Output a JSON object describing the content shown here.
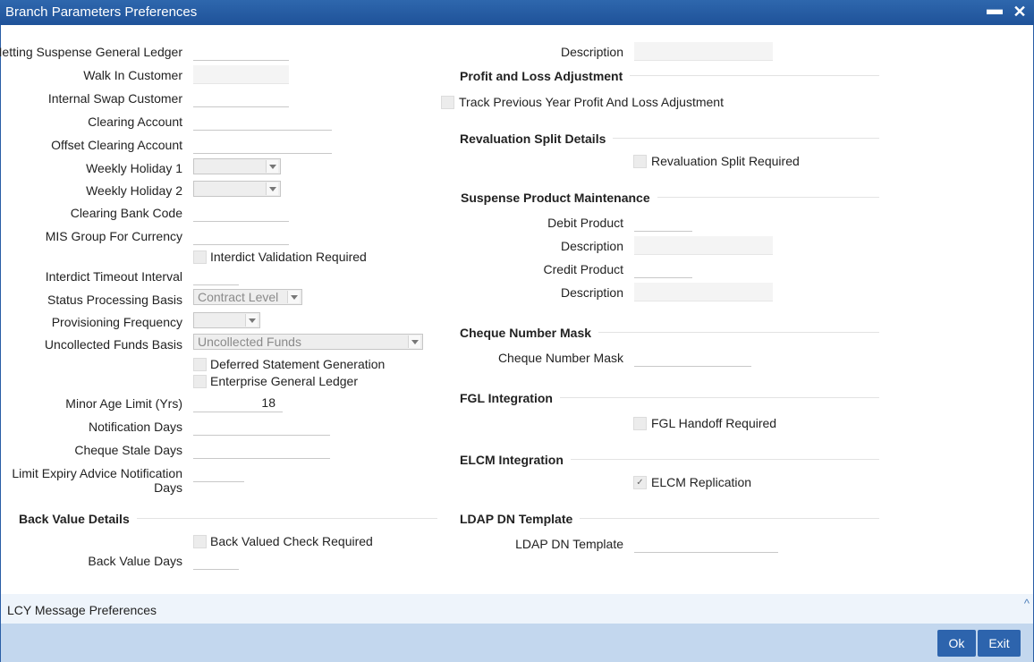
{
  "window": {
    "title": "Branch Parameters Preferences",
    "minimize_glyph": "▬",
    "close_glyph": "✕"
  },
  "left": {
    "netting_suspense_gl": "Netting Suspense General Ledger",
    "walk_in_customer": "Walk In Customer",
    "internal_swap_customer": "Internal Swap Customer",
    "clearing_account": "Clearing Account",
    "offset_clearing_account": "Offset Clearing Account",
    "weekly_holiday_1": "Weekly Holiday 1",
    "weekly_holiday_2": "Weekly Holiday 2",
    "clearing_bank_code": "Clearing Bank Code",
    "mis_group_for_currency": "MIS Group For Currency",
    "interdict_validation_required": "Interdict Validation Required",
    "interdict_timeout_interval": "Interdict Timeout Interval",
    "status_processing_basis": "Status Processing Basis",
    "status_processing_basis_value": "Contract Level",
    "provisioning_frequency": "Provisioning Frequency",
    "uncollected_funds_basis": "Uncollected Funds Basis",
    "uncollected_funds_basis_value": "Uncollected Funds",
    "deferred_statement_generation": "Deferred Statement Generation",
    "enterprise_general_ledger": "Enterprise General Ledger",
    "minor_age_limit": "Minor Age Limit (Yrs)",
    "minor_age_limit_value": "18",
    "notification_days": "Notification Days",
    "cheque_stale_days": "Cheque Stale Days",
    "limit_expiry_line1": "Limit Expiry Advice Notification",
    "limit_expiry_line2": "Days"
  },
  "back_value": {
    "section": "Back Value Details",
    "check_required": "Back Valued Check Required",
    "days": "Back Value Days"
  },
  "right": {
    "description": "Description",
    "pl_section": "Profit and Loss Adjustment",
    "pl_track": "Track Previous Year Profit And Loss Adjustment",
    "reval_section": "Revaluation Split Details",
    "reval_required": "Revaluation Split Required",
    "suspense_section": "Suspense Product Maintenance",
    "debit_product": "Debit Product",
    "debit_description": "Description",
    "credit_product": "Credit Product",
    "credit_description": "Description",
    "cheque_section": "Cheque Number Mask",
    "cheque_mask": "Cheque Number Mask",
    "fgl_section": "FGL Integration",
    "fgl_handoff": "FGL Handoff Required",
    "elcm_section": "ELCM Integration",
    "elcm_replication": "ELCM Replication",
    "elcm_checked_glyph": "✓",
    "ldap_section": "LDAP DN Template",
    "ldap_template": "LDAP DN Template"
  },
  "lcy": {
    "label": "LCY Message Preferences",
    "caret": "^"
  },
  "buttons": {
    "ok": "Ok",
    "exit": "Exit"
  }
}
